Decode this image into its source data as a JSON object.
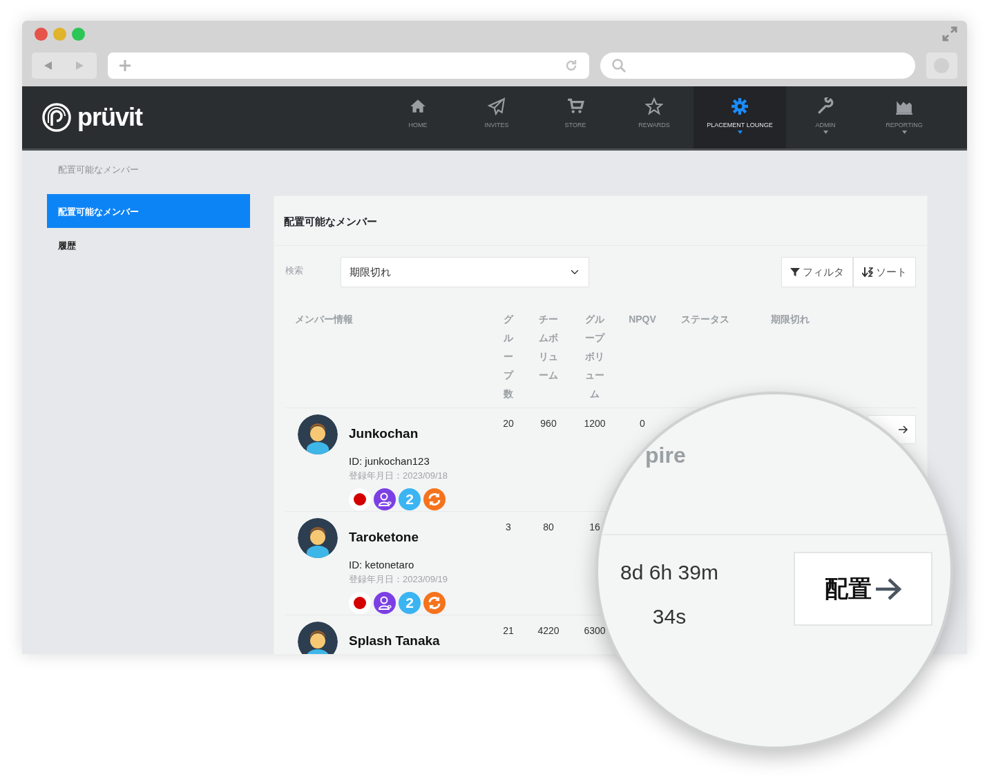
{
  "nav": {
    "logo": "prüvit",
    "items": [
      {
        "label": "HOME",
        "kind": "home",
        "selected": false,
        "dropdown": false
      },
      {
        "label": "INVITES",
        "kind": "plane",
        "selected": false,
        "dropdown": false
      },
      {
        "label": "STORE",
        "kind": "cart",
        "selected": false,
        "dropdown": false
      },
      {
        "label": "REWARDS",
        "kind": "star",
        "selected": false,
        "dropdown": false
      },
      {
        "label": "PLACEMENT LOUNGE",
        "kind": "gear",
        "selected": true,
        "dropdown": true
      },
      {
        "label": "ADMIN",
        "kind": "wrench",
        "selected": false,
        "dropdown": true
      },
      {
        "label": "REPORTING",
        "kind": "chart",
        "selected": false,
        "dropdown": true
      }
    ]
  },
  "breadcrumb": "配置可能なメンバー",
  "sidebar": {
    "items": [
      {
        "label": "配置可能なメンバー",
        "selected": true
      },
      {
        "label": "履歴",
        "selected": false
      }
    ]
  },
  "card": {
    "title": "配置可能なメンバー",
    "search_label": "検索",
    "search_value": "期限切れ",
    "filter_button": "フィルタ",
    "sort_button": "ソート"
  },
  "table": {
    "columns": [
      "メンバー情報",
      "グループ数",
      "チームボリューム",
      "グループボリューム",
      "NPQV",
      "ステータス",
      "期限切れ"
    ],
    "rows": [
      {
        "name": "Junkochan",
        "id": "ID: junkochan123",
        "registered": "登録年月日：2023/09/18",
        "action_button": true,
        "group_count": "20",
        "team_volume": "960",
        "group_volume": "1200",
        "npqv": "0",
        "badges": [
          {
            "kind": "dot"
          },
          {
            "kind": "user"
          },
          {
            "kind": "number",
            "text": "2"
          },
          {
            "kind": "sync"
          }
        ]
      },
      {
        "name": "Taroketone",
        "id": "ID: ketonetaro",
        "registered": "登録年月日：2023/09/19",
        "group_count": "3",
        "team_volume": "80",
        "group_volume": "16",
        "badges": [
          {
            "kind": "dot"
          },
          {
            "kind": "user"
          },
          {
            "kind": "number",
            "text": "2"
          },
          {
            "kind": "sync"
          }
        ]
      },
      {
        "name": "Splash Tanaka",
        "group_count": "21",
        "team_volume": "4220",
        "group_volume": "6300",
        "badges": []
      }
    ]
  },
  "magnifier": {
    "status_text": "pire",
    "countdown": [
      "8d 6h 39m",
      "34s"
    ],
    "button": "配置"
  }
}
